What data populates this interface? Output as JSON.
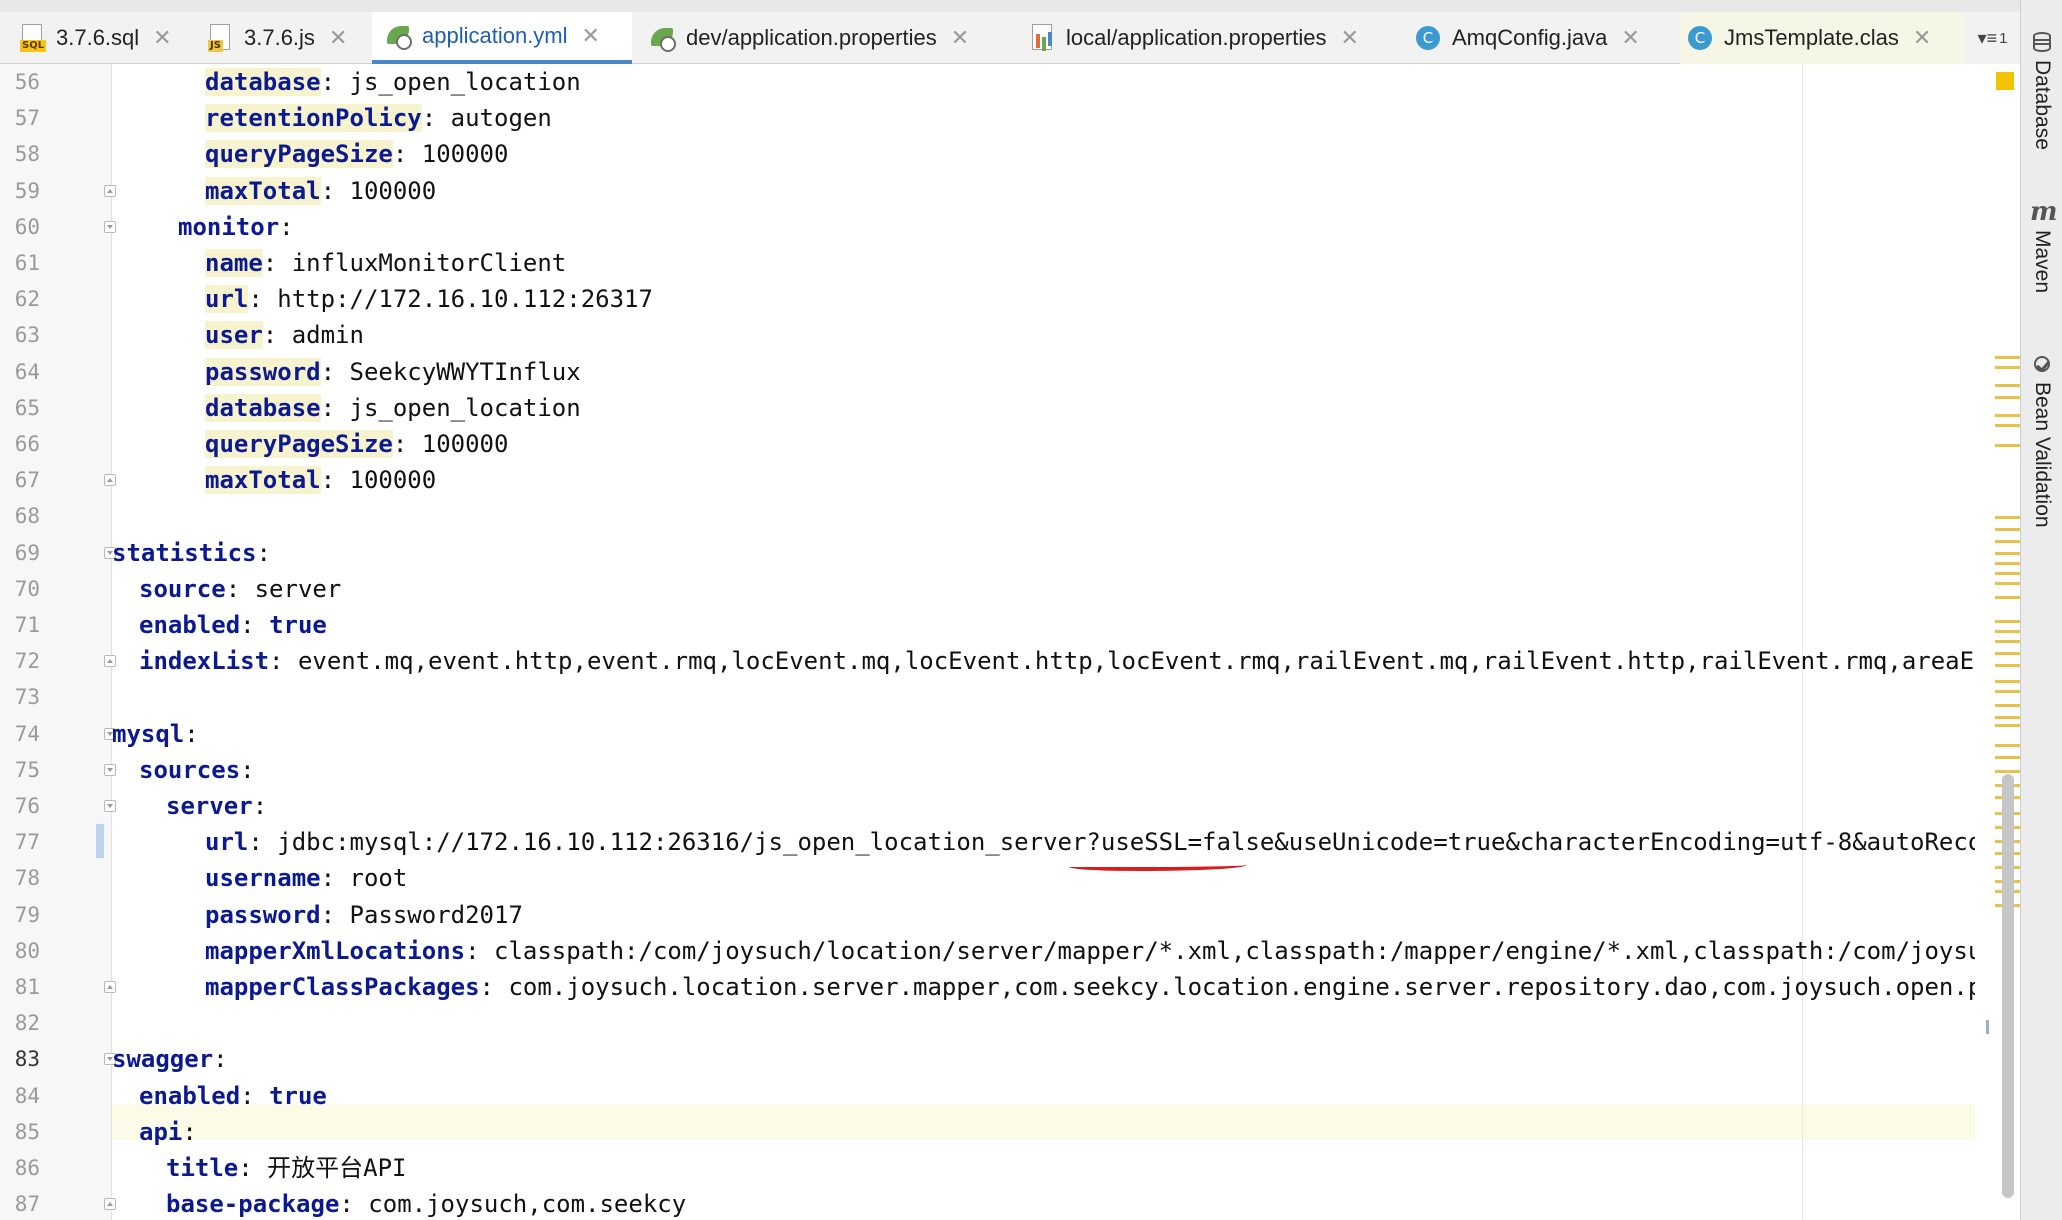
{
  "tabs": [
    {
      "label": "3.7.6.sql",
      "icon": "sql-file-icon",
      "tag": "SQL",
      "active": false
    },
    {
      "label": "3.7.6.js",
      "icon": "js-file-icon",
      "tag": "JS",
      "active": false
    },
    {
      "label": "application.yml",
      "icon": "spring-yaml-icon",
      "active": true
    },
    {
      "label": "dev/application.properties",
      "icon": "spring-properties-icon",
      "active": false
    },
    {
      "label": "local/application.properties",
      "icon": "properties-file-icon",
      "active": false
    },
    {
      "label": "AmqConfig.java",
      "icon": "java-class-icon",
      "active": false
    },
    {
      "label": "JmsTemplate.clas",
      "icon": "java-class-icon",
      "active": false
    }
  ],
  "tab_overflow": {
    "label": "1",
    "icon": "tab-list-icon"
  },
  "editor": {
    "accent_color": "#0b1a8f",
    "highlight_color": "#f8f3cf",
    "underline_color": "#d91c1c",
    "current_line": 83,
    "lines": [
      {
        "n": "56",
        "key": "database",
        "sep": ": ",
        "val": "js_open_location"
      },
      {
        "n": "57",
        "key": "retentionPolicy",
        "sep": ": ",
        "val": "autogen"
      },
      {
        "n": "58",
        "key": "queryPageSize",
        "sep": ": ",
        "val": "100000"
      },
      {
        "n": "59",
        "key": "maxTotal",
        "sep": ": ",
        "val": "100000"
      },
      {
        "n": "60",
        "key": "monitor",
        "sep": ":",
        "val": ""
      },
      {
        "n": "61",
        "key": "name",
        "sep": ": ",
        "val": "influxMonitorClient"
      },
      {
        "n": "62",
        "key": "url",
        "sep": ": ",
        "val": "http://172.16.10.112:26317"
      },
      {
        "n": "63",
        "key": "user",
        "sep": ": ",
        "val": "admin"
      },
      {
        "n": "64",
        "key": "password",
        "sep": ": ",
        "val": "SeekcyWWYTInflux"
      },
      {
        "n": "65",
        "key": "database",
        "sep": ": ",
        "val": "js_open_location"
      },
      {
        "n": "66",
        "key": "queryPageSize",
        "sep": ": ",
        "val": "100000"
      },
      {
        "n": "67",
        "key": "maxTotal",
        "sep": ": ",
        "val": "100000"
      },
      {
        "n": "68",
        "key": "",
        "sep": "",
        "val": ""
      },
      {
        "n": "69",
        "key": "statistics",
        "sep": ":",
        "val": ""
      },
      {
        "n": "70",
        "key": "source",
        "sep": ": ",
        "val": "server"
      },
      {
        "n": "71",
        "key": "enabled",
        "sep": ": ",
        "val": "true"
      },
      {
        "n": "72",
        "key": "indexList",
        "sep": ": ",
        "val": "event.mq,event.http,event.rmq,locEvent.mq,locEvent.http,locEvent.rmq,railEvent.mq,railEvent.http,railEvent.rmq,areaEvent.mq"
      },
      {
        "n": "73",
        "key": "",
        "sep": "",
        "val": ""
      },
      {
        "n": "74",
        "key": "mysql",
        "sep": ":",
        "val": ""
      },
      {
        "n": "75",
        "key": "sources",
        "sep": ":",
        "val": ""
      },
      {
        "n": "76",
        "key": "server",
        "sep": ":",
        "val": ""
      },
      {
        "n": "77",
        "key": "url",
        "sep": ": ",
        "val": "jdbc:mysql://172.16.10.112:26316/js_open_location_server?useSSL=false&useUnicode=true&characterEncoding=utf-8&autoReconnect=t"
      },
      {
        "n": "78",
        "key": "username",
        "sep": ": ",
        "val": "root"
      },
      {
        "n": "79",
        "key": "password",
        "sep": ": ",
        "val": "Password2017"
      },
      {
        "n": "80",
        "key": "mapperXmlLocations",
        "sep": ": ",
        "val": "classpath:/com/joysuch/location/server/mapper/*.xml,classpath:/mapper/engine/*.xml,classpath:/com/joysuch/open"
      },
      {
        "n": "81",
        "key": "mapperClassPackages",
        "sep": ": ",
        "val": "com.joysuch.location.server.mapper,com.seekcy.location.engine.server.repository.dao,com.joysuch.open.platform"
      },
      {
        "n": "82",
        "key": "",
        "sep": "",
        "val": ""
      },
      {
        "n": "83",
        "key": "swagger",
        "sep": ":",
        "val": ""
      },
      {
        "n": "84",
        "key": "enabled",
        "sep": ": ",
        "val": "true"
      },
      {
        "n": "85",
        "key": "api",
        "sep": ":",
        "val": ""
      },
      {
        "n": "86",
        "key": "title",
        "sep": ": ",
        "val": "开放平台API"
      },
      {
        "n": "87",
        "key": "base-package",
        "sep": ": ",
        "val": "com.joysuch,com.seekcy"
      }
    ]
  },
  "right_toolbar": [
    {
      "label": "Database",
      "icon": "database-icon"
    },
    {
      "label": "Maven",
      "icon": "maven-icon"
    },
    {
      "label": "Bean Validation",
      "icon": "bean-validation-icon"
    }
  ]
}
